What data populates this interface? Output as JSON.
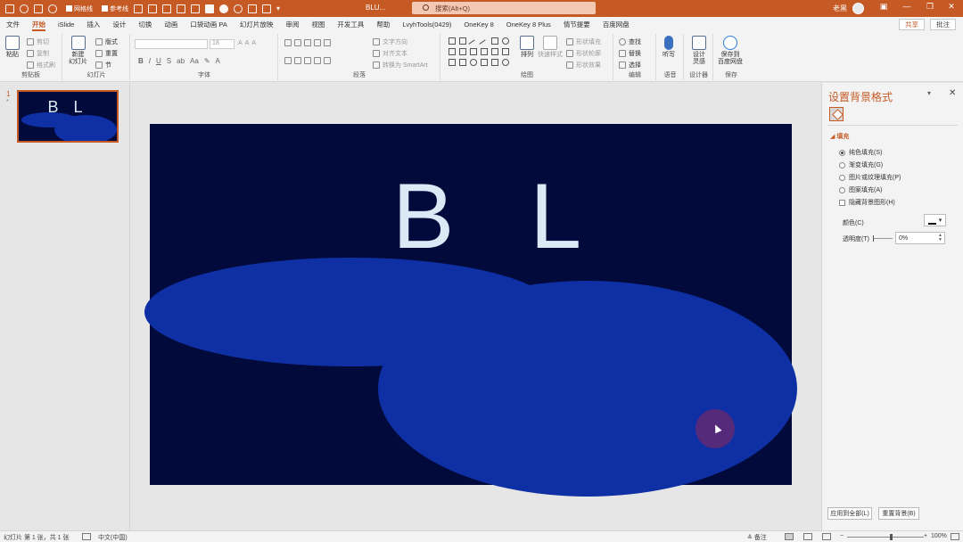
{
  "titlebar": {
    "checkbox1": "网格线",
    "checkbox2": "参考线",
    "filename": "BLU...",
    "search_placeholder": "搜索(Alt+Q)",
    "user_name": "老黑",
    "min": "—",
    "restore": "❐",
    "close": "✕",
    "ribbon_opts": "▣"
  },
  "tabs": [
    "文件",
    "开始",
    "iSlide",
    "插入",
    "设计",
    "切换",
    "动画",
    "口袋动画 PA",
    "幻灯片放映",
    "审阅",
    "视图",
    "开发工具",
    "帮助",
    "LvyhTools(0429)",
    "OneKey 8",
    "OneKey 8 Plus",
    "情节提要",
    "百度网盘"
  ],
  "active_tab": "开始",
  "menu_right": {
    "share": "共享",
    "comment": "批注"
  },
  "ribbon": {
    "clipboard": {
      "paste": "粘贴",
      "cut": "剪切",
      "copy": "复制",
      "format_painter": "格式刷",
      "label": "剪贴板"
    },
    "slides": {
      "new_slide_1": "新建",
      "new_slide_2": "幻灯片",
      "layout": "版式",
      "reset": "重置",
      "section": "节",
      "label": "幻灯片"
    },
    "font": {
      "size_value": "18",
      "bold": "B",
      "italic": "I",
      "underline": "U",
      "strike": "S",
      "label": "字体"
    },
    "paragraph": {
      "text_direction": "文字方向",
      "align_text": "对齐文本",
      "smartart": "转换为 SmartArt",
      "label": "段落"
    },
    "drawing": {
      "arrange": "排列",
      "quick_styles": "快速样式",
      "shape_fill": "形状填充",
      "shape_outline": "形状轮廓",
      "shape_effects": "形状效果",
      "label": "绘图"
    },
    "editing": {
      "find": "查找",
      "replace": "替换",
      "select": "选择",
      "label": "编辑"
    },
    "voice": {
      "dictate": "听写",
      "label": "语音"
    },
    "designer": {
      "design_ideas_1": "设计",
      "design_ideas_2": "灵感",
      "label": "设计器"
    },
    "save": {
      "save_to_1": "保存到",
      "save_to_2": "百度网盘",
      "label": "保存"
    }
  },
  "thumbnail": {
    "number": "1",
    "star": "*",
    "title": "B L"
  },
  "slide": {
    "title": "B L",
    "bg_color": "#020a3b",
    "ellipse_color": "#0f30a5",
    "title_color": "#dbe9f6"
  },
  "format_pane": {
    "title": "设置背景格式",
    "dropdown": "▾",
    "close": "✕",
    "section_fill": "填充",
    "options": [
      "纯色填充(S)",
      "渐变填充(G)",
      "图片或纹理填充(P)",
      "图案填充(A)"
    ],
    "selected_option": "纯色填充(S)",
    "hide_graphics": "隐藏背景图形(H)",
    "color_label": "颜色(C)",
    "transparency_label": "透明度(T)",
    "transparency_value": "0%",
    "apply_all": "应用到全部(L)",
    "reset_bg": "重置背景(B)"
  },
  "statusbar": {
    "slide_info": "幻灯片 第 1 张，共 1 张",
    "language": "中文(中国)",
    "notes": "备注",
    "zoom": "100%",
    "zoom_minus": "−",
    "zoom_plus": "+"
  }
}
